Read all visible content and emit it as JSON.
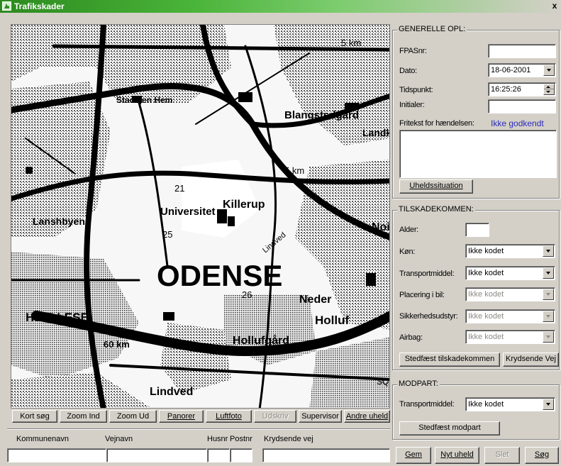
{
  "window": {
    "title": "Trafikskader",
    "close_glyph": "x"
  },
  "map": {
    "labels": {
      "odense": "ODENSE",
      "universitet": "Universitet",
      "killerup": "Killerup",
      "blangstedgaard": "Blangstedgård",
      "lindved": "Lindved",
      "hollufgaard": "Hollufgård",
      "holluf": "Holluf",
      "neder": "Neder",
      "lanshbyen": "Lanshbyen",
      "hjallese": "HJALLESE",
      "km5a": "5 km",
      "km5b": "5 km",
      "km60": "60 km",
      "n21": "21",
      "n25": "25",
      "n26": "26",
      "landk": "Landk",
      "noi": "Noi",
      "sq": "SQ",
      "lindved_road": "Lindved",
      "scattered_text": "Stadsjen Hem"
    }
  },
  "toolbar": {
    "kort_sog": "Kort søg",
    "zoom_ind": "Zoom Ind",
    "zoom_ud": "Zoom Ud",
    "panorer": "Panorer",
    "luftfoto": "Luftfoto",
    "udskriv": "Udskriv",
    "supervisor": "Supervisor",
    "andre_uheld": "Andre uheld"
  },
  "address": {
    "kommunenavn": "Kommunenavn",
    "vejnavn": "Vejnavn",
    "husnr": "Husnr",
    "postnr": "Postnr",
    "krydsende_vej": "Krydsende vej"
  },
  "general": {
    "title": "GENERELLE OPL:",
    "fpasnr_label": "FPASnr:",
    "fpasnr_value": "",
    "dato_label": "Dato:",
    "dato_value": "18-06-2001",
    "tidspunkt_label": "Tidspunkt:",
    "tidspunkt_value": "16:25:26",
    "initialer_label": "Initialer:",
    "initialer_value": "",
    "fritekst_label": "Fritekst for hændelsen:",
    "status": "Ikke godkendt",
    "uheldssituation": "Uheldssituation"
  },
  "injured": {
    "title": "TILSKADEKOMMEN:",
    "alder_label": "Alder:",
    "alder_value": "",
    "kon_label": "Køn:",
    "kon_value": "Ikke kodet",
    "transport_label": "Transportmiddel:",
    "transport_value": "Ikke kodet",
    "placering_label": "Placering i bil:",
    "placering_value": "Ikke kodet",
    "sikkerhed_label": "Sikkerhedsudstyr:",
    "sikkerhed_value": "Ikke kodet",
    "airbag_label": "Airbag:",
    "airbag_value": "Ikke kodet",
    "stedfaest_btn": "Stedfæst tilskadekommen",
    "krydsende_btn": "Krydsende Vej"
  },
  "opponent": {
    "title": "MODPART:",
    "transport_label": "Transportmiddel:",
    "transport_value": "Ikke kodet",
    "stedfaest_btn": "Stedfæst modpart"
  },
  "actions": {
    "gem": "Gem",
    "nyt_uheld": "Nyt uheld",
    "slet": "Slet",
    "sog": "Søg"
  },
  "colors": {
    "titlebar": "#2b8a1e",
    "face": "#d4d0c8",
    "status": "#2c2cb8"
  }
}
